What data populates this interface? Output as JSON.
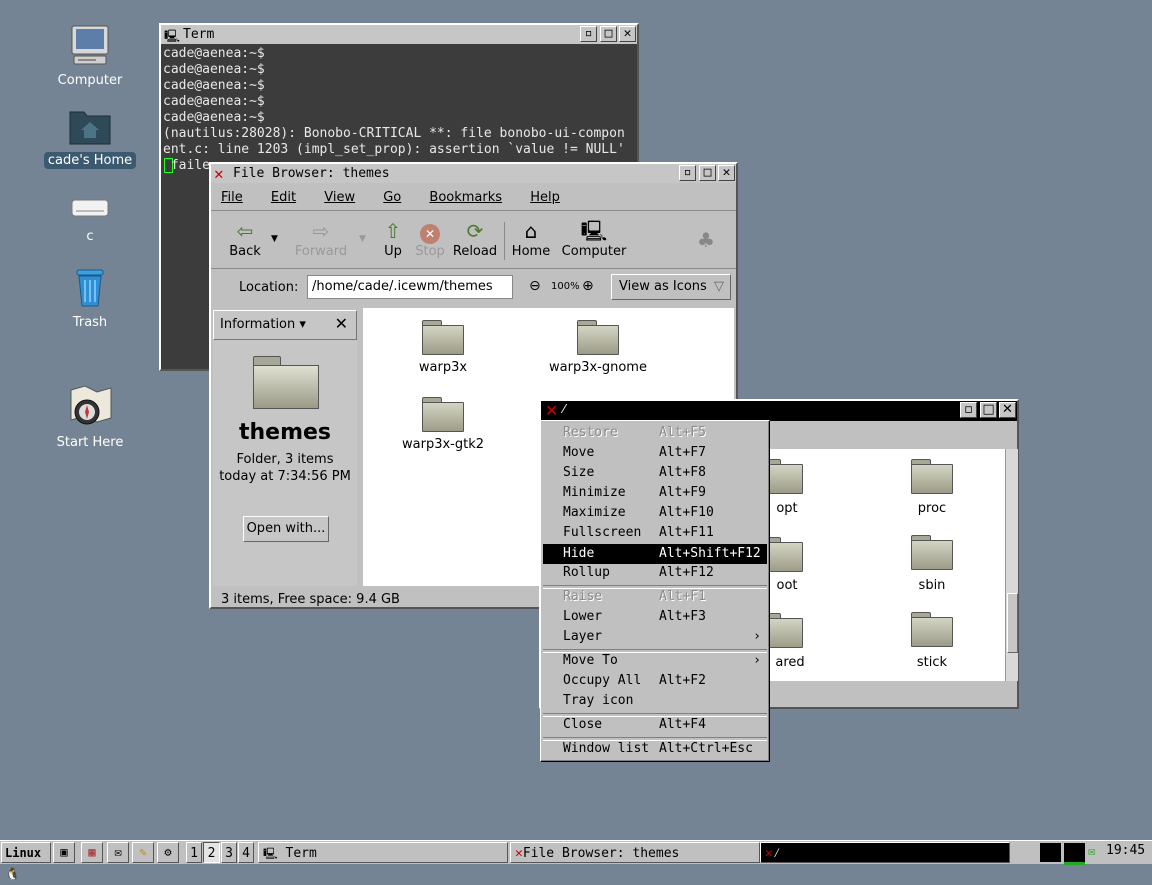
{
  "desktop_icons": [
    {
      "name": "computer",
      "label": "Computer"
    },
    {
      "name": "home",
      "label": "cade's Home"
    },
    {
      "name": "drive-c",
      "label": "c"
    },
    {
      "name": "trash",
      "label": "Trash"
    },
    {
      "name": "start-here",
      "label": "Start Here"
    }
  ],
  "term": {
    "title": "Term",
    "lines": [
      "cade@aenea:~$",
      "cade@aenea:~$",
      "cade@aenea:~$",
      "cade@aenea:~$",
      "cade@aenea:~$",
      "(nautilus:28028): Bonobo-CRITICAL **: file bonobo-ui-compon",
      "ent.c: line 1203 (impl_set_prop): assertion `value != NULL'",
      " faile"
    ]
  },
  "filebrowser": {
    "title": "File Browser: themes",
    "menu": [
      "File",
      "Edit",
      "View",
      "Go",
      "Bookmarks",
      "Help"
    ],
    "toolbar": {
      "back": "Back",
      "forward": "Forward",
      "up": "Up",
      "stop": "Stop",
      "reload": "Reload",
      "home": "Home",
      "computer": "Computer"
    },
    "location_label": "Location:",
    "location_value": "/home/cade/.icewm/themes",
    "zoom": "100%",
    "view_as": "View as Icons",
    "sidebar": {
      "selector": "Information",
      "name": "themes",
      "info": "Folder, 3 items",
      "date": "today at 7:34:56 PM",
      "open_with": "Open with..."
    },
    "files": [
      "warp3x",
      "warp3x-gnome",
      "warp3x-gtk2"
    ],
    "status": "3 items, Free space: 9.4 GB"
  },
  "second_window": {
    "files": [
      "opt",
      "proc",
      "oot",
      "sbin",
      "ared",
      "stick"
    ]
  },
  "window_menu": {
    "items": [
      {
        "label": "Restore",
        "key": "Alt+F5",
        "state": "disabled"
      },
      {
        "label": "Move",
        "key": "Alt+F7"
      },
      {
        "label": "Size",
        "key": "Alt+F8"
      },
      {
        "label": "Minimize",
        "key": "Alt+F9"
      },
      {
        "label": "Maximize",
        "key": "Alt+F10"
      },
      {
        "label": "Fullscreen",
        "key": "Alt+F11"
      },
      {
        "label": "Hide",
        "key": "Alt+Shift+F12",
        "state": "highlight"
      },
      {
        "label": "Rollup",
        "key": "Alt+F12"
      },
      {
        "label": "Raise",
        "key": "Alt+F1",
        "state": "disabled"
      },
      {
        "label": "Lower",
        "key": "Alt+F3"
      },
      {
        "label": "Layer",
        "key": ""
      },
      {
        "label": "Move To",
        "key": ""
      },
      {
        "label": "Occupy All",
        "key": "Alt+F2"
      },
      {
        "label": "Tray icon",
        "key": ""
      },
      {
        "label": "Close",
        "key": "Alt+F4"
      },
      {
        "label": "Window list",
        "key": "Alt+Ctrl+Esc"
      }
    ]
  },
  "taskbar": {
    "start": "Linux",
    "workspaces": [
      "1",
      "2",
      "3",
      "4"
    ],
    "active_workspace": "2",
    "tasks": [
      "Term",
      "File Browser: themes"
    ],
    "clock": "19:45"
  },
  "colors": {
    "desktop": "#748494",
    "term_bg": "#3c3c3c",
    "menu_highlight": "#000000"
  }
}
